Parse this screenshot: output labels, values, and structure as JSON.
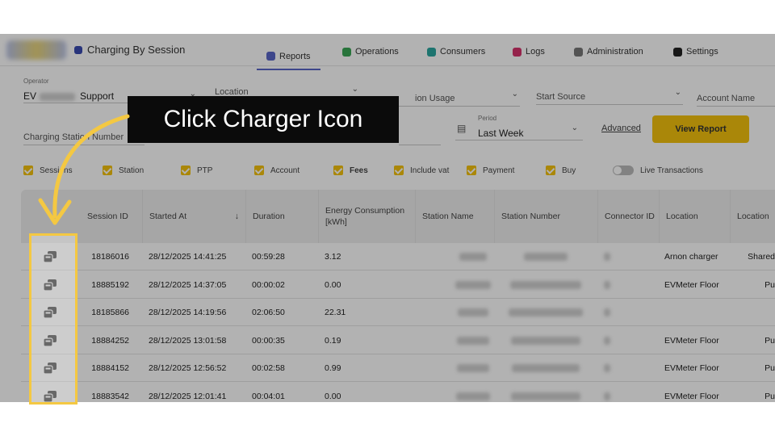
{
  "header": {
    "page_title": "Charging By Session",
    "tabs": [
      {
        "label": "Reports",
        "icon": "chart-icon",
        "color": "#5a66c8"
      },
      {
        "label": "Operations",
        "icon": "operations-icon",
        "color": "#3aa655"
      },
      {
        "label": "Consumers",
        "icon": "consumers-icon",
        "color": "#2aa6a0"
      },
      {
        "label": "Logs",
        "icon": "logs-icon",
        "color": "#d6336c"
      },
      {
        "label": "Administration",
        "icon": "admin-icon",
        "color": "#777777"
      },
      {
        "label": "Settings",
        "icon": "settings-icon",
        "color": "#222222"
      }
    ]
  },
  "filters": {
    "operator_label": "Operator",
    "operator_value_prefix": "EV",
    "operator_value_suffix": "Support",
    "location_placeholder": "Location",
    "station_usage_placeholder": "ion Usage",
    "start_source_placeholder": "Start Source",
    "account_name_placeholder": "Account Name",
    "charging_station_placeholder": "Charging Station Number",
    "period_label": "Period",
    "period_value": "Last Week",
    "advanced_label": "Advanced",
    "view_report_label": "View Report"
  },
  "checkboxes": [
    {
      "label": "Sessions",
      "checked": true
    },
    {
      "label": "Station",
      "checked": true
    },
    {
      "label": "PTP",
      "checked": true
    },
    {
      "label": "Account",
      "checked": true
    },
    {
      "label": "Fees",
      "checked": true
    },
    {
      "label": "Include vat",
      "checked": true
    },
    {
      "label": "Payment",
      "checked": true
    },
    {
      "label": "Buy",
      "checked": true
    }
  ],
  "live_transactions_label": "Live Transactions",
  "table": {
    "columns": [
      "Session ID",
      "Started At",
      "Duration",
      "Energy Consumption [kWh]",
      "Station Name",
      "Station Number",
      "Connector ID",
      "Location",
      "Location"
    ],
    "rows": [
      {
        "session_id": "18186016",
        "started_at": "28/12/2025 14:41:25",
        "duration": "00:59:28",
        "energy": "3.12",
        "location": "Arnon charger",
        "location_type": "Shared"
      },
      {
        "session_id": "18885192",
        "started_at": "28/12/2025 14:37:05",
        "duration": "00:00:02",
        "energy": "0.00",
        "location": "EVMeter Floor",
        "location_type": "Pu"
      },
      {
        "session_id": "18185866",
        "started_at": "28/12/2025 14:19:56",
        "duration": "02:06:50",
        "energy": "22.31",
        "location": "",
        "location_type": ""
      },
      {
        "session_id": "18884252",
        "started_at": "28/12/2025 13:01:58",
        "duration": "00:00:35",
        "energy": "0.19",
        "location": "EVMeter Floor",
        "location_type": "Pu"
      },
      {
        "session_id": "18884152",
        "started_at": "28/12/2025 12:56:52",
        "duration": "00:02:58",
        "energy": "0.99",
        "location": "EVMeter Floor",
        "location_type": "Pu"
      },
      {
        "session_id": "18883542",
        "started_at": "28/12/2025 12:01:41",
        "duration": "00:04:01",
        "energy": "0.00",
        "location": "EVMeter Floor",
        "location_type": "Pu"
      }
    ]
  },
  "callout": {
    "text": "Click Charger Icon",
    "highlight_color": "#f4c842"
  },
  "colors": {
    "accent": "#f4c20d",
    "tab_underline": "#5a66c8"
  }
}
